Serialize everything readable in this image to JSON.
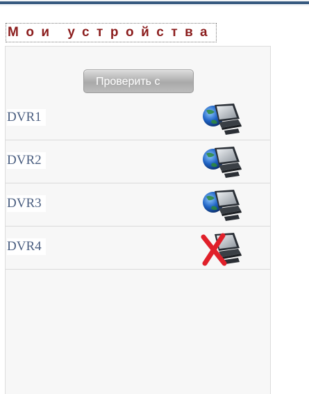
{
  "page": {
    "title": "Мои устройства"
  },
  "toolbar": {
    "check_label": "Проверить с"
  },
  "devices": [
    {
      "name": "DVR1",
      "status": "online",
      "icon": "network-computer-icon"
    },
    {
      "name": "DVR2",
      "status": "online",
      "icon": "network-computer-icon"
    },
    {
      "name": "DVR3",
      "status": "online",
      "icon": "network-computer-icon"
    },
    {
      "name": "DVR4",
      "status": "offline",
      "icon": "network-computer-offline-icon"
    }
  ],
  "colors": {
    "title": "#8b1d1d",
    "link": "#4a5e80",
    "top_bar": "#375a80",
    "offline_mark": "#e0202a"
  }
}
